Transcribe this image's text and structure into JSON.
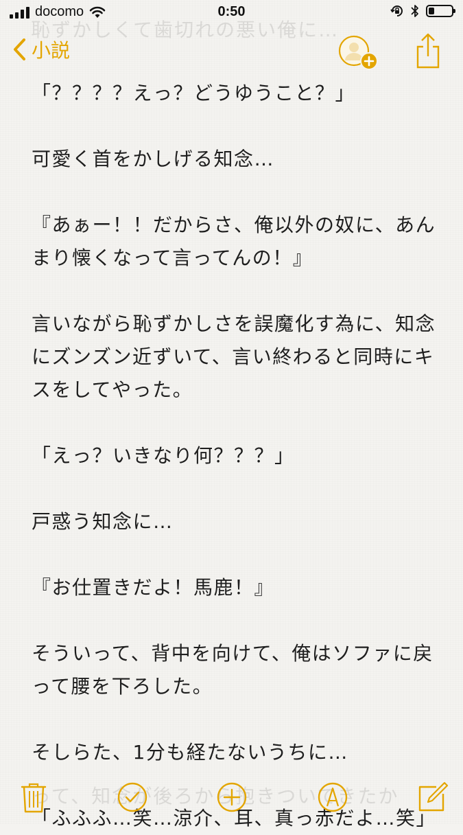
{
  "status_bar": {
    "carrier": "docomo",
    "time": "0:50",
    "signal_bars": 4,
    "battery_level": 0.25,
    "icons": [
      "signal-icon",
      "wifi-icon",
      "orientation-lock-icon",
      "bluetooth-icon",
      "battery-icon"
    ]
  },
  "nav": {
    "back_label": "小説",
    "ghost_title": "恥ずかしくて歯切れの悪い俺に…"
  },
  "note": {
    "paragraphs": [
      "「？？？？えっ？どうゆうこと？」",
      "可愛く首をかしげる知念…",
      "『あぁー！！だからさ、俺以外の奴に、あん\nまり懐くなって言ってんの！』",
      "言いながら恥ずかしさを誤魔化す為に、知念\nにズンズン近ずいて、言い終わると同時にキ\nスをしてやった。",
      "「えっ？いきなり何？？？」",
      "戸惑う知念に…",
      "『お仕置きだよ！馬鹿！』",
      "そういって、背中を向けて、俺はソファに戻\nって腰を下ろした。",
      "そしらた、1分も経たないうちに…",
      "「ふふふ…笑…涼介、耳、真っ赤だよ…笑」"
    ],
    "ghost_bottom": "って、知念が後ろから抱きついてきたか"
  },
  "colors": {
    "accent": "#e3a500",
    "background": "#f4f3f0",
    "text": "#1e1e1e"
  },
  "toolbar": {
    "icons": [
      "trash-icon",
      "checklist-icon",
      "add-icon",
      "markup-icon",
      "compose-icon"
    ]
  }
}
